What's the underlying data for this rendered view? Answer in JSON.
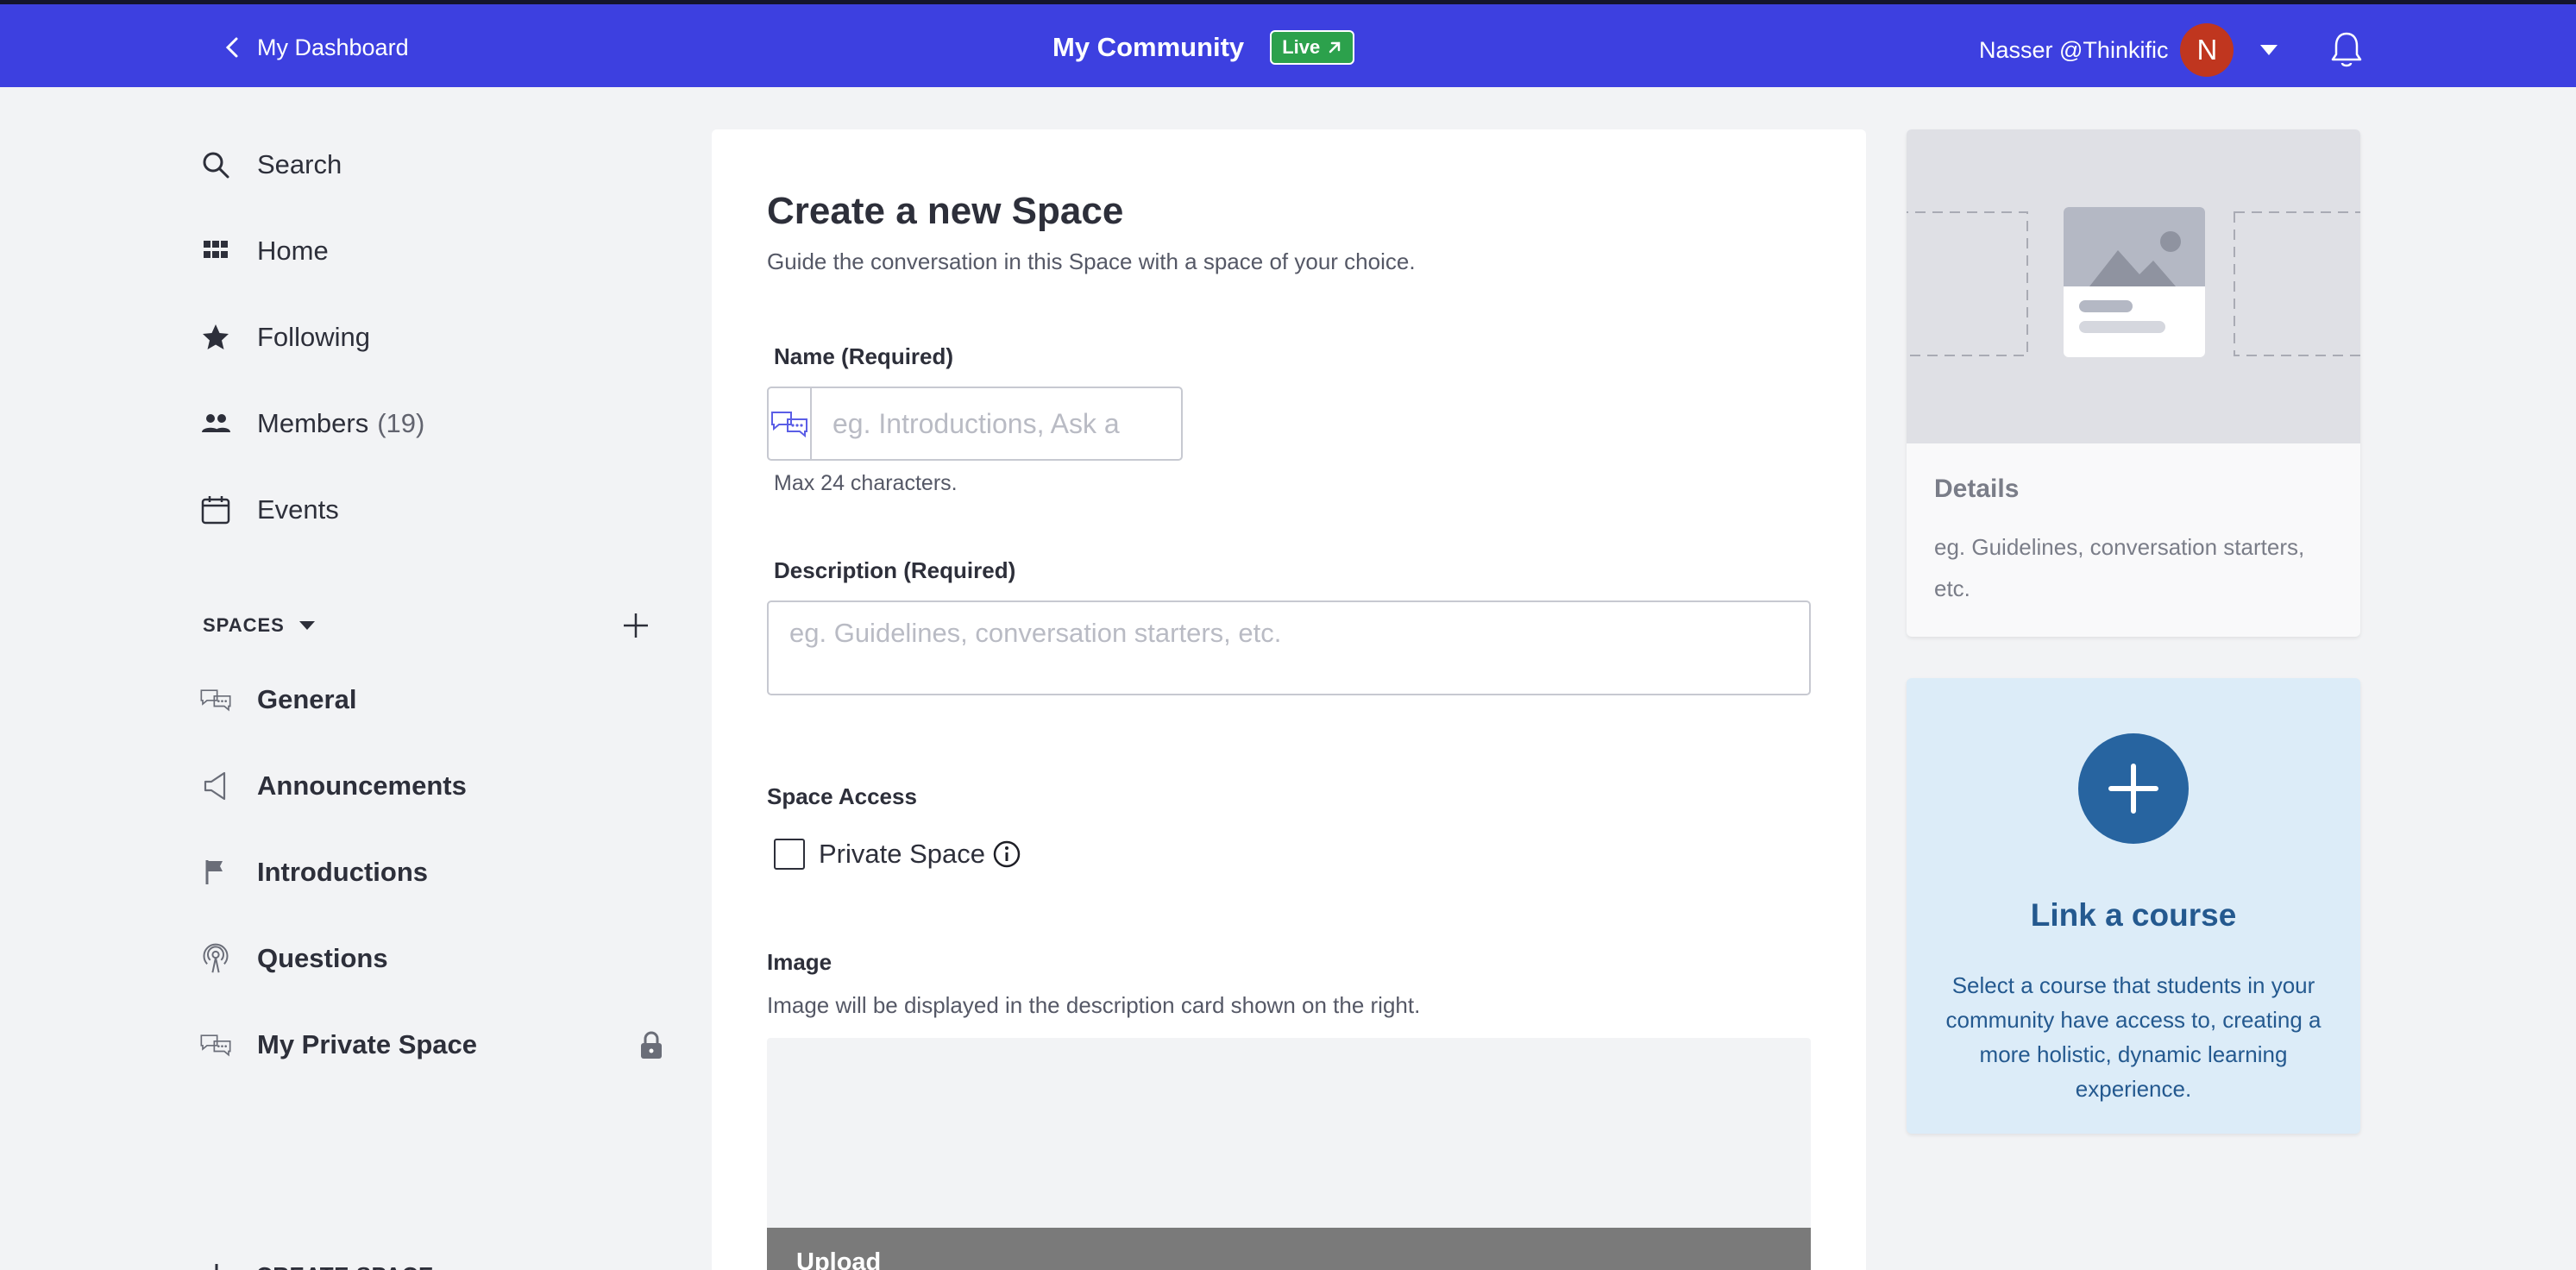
{
  "header": {
    "back_label": "My Dashboard",
    "community_title": "My Community",
    "live_label": "Live",
    "user_name": "Nasser @Thinkific",
    "avatar_initial": "N"
  },
  "sidebar": {
    "nav": [
      {
        "label": "Search",
        "icon": "search-icon"
      },
      {
        "label": "Home",
        "icon": "grid-icon"
      },
      {
        "label": "Following",
        "icon": "star-icon"
      },
      {
        "label": "Members",
        "count": "(19)",
        "icon": "people-icon"
      },
      {
        "label": "Events",
        "icon": "calendar-icon"
      }
    ],
    "spaces_label": "SPACES",
    "spaces": [
      {
        "label": "General",
        "icon": "chat-bubbles-icon"
      },
      {
        "label": "Announcements",
        "icon": "megaphone-icon"
      },
      {
        "label": "Introductions",
        "icon": "flag-icon"
      },
      {
        "label": "Questions",
        "icon": "broadcast-icon"
      },
      {
        "label": "My Private Space",
        "icon": "chat-bubbles-icon",
        "locked": true
      }
    ],
    "create_space_label": "CREATE SPACE"
  },
  "form": {
    "title": "Create a new Space",
    "subtitle": "Guide the conversation in this Space with a space of your choice.",
    "name_label": "Name (Required)",
    "name_placeholder": "eg. Introductions, Ask a",
    "name_hint": "Max 24 characters.",
    "description_label": "Description (Required)",
    "description_placeholder": "eg. Guidelines, conversation starters, etc.",
    "access_label": "Space Access",
    "private_label": "Private Space",
    "image_label": "Image",
    "image_subtitle": "Image will be displayed in the description card shown on the right.",
    "upload_label": "Upload"
  },
  "preview": {
    "details_title": "Details",
    "details_text": "eg. Guidelines, conversation starters, etc."
  },
  "link_course": {
    "title": "Link a course",
    "text": "Select a course that students in your community have access to, creating a more holistic, dynamic learning experience."
  },
  "colors": {
    "header_bg": "#3d40e0",
    "live_badge": "#2ca14c",
    "avatar_bg": "#c0361f",
    "link_accent": "#2764a0",
    "link_card_bg": "#dcecf8"
  }
}
